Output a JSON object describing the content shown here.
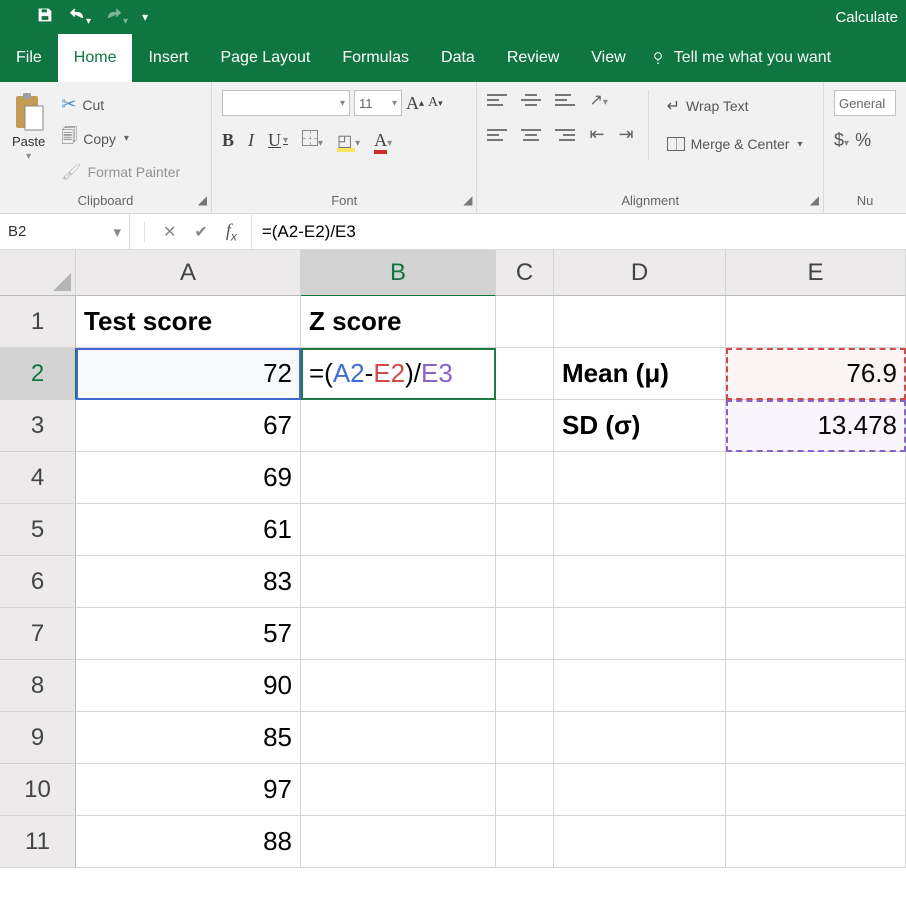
{
  "titlebar": {
    "right_text": "Calculate"
  },
  "tabs": {
    "file": "File",
    "home": "Home",
    "insert": "Insert",
    "page_layout": "Page Layout",
    "formulas": "Formulas",
    "data": "Data",
    "review": "Review",
    "view": "View",
    "tell_me": "Tell me what you want"
  },
  "ribbon": {
    "clipboard": {
      "paste": "Paste",
      "cut": "Cut",
      "copy": "Copy",
      "format_painter": "Format Painter",
      "label": "Clipboard"
    },
    "font": {
      "name": "",
      "size": "11",
      "label": "Font"
    },
    "alignment": {
      "wrap": "Wrap Text",
      "merge": "Merge & Center",
      "label": "Alignment"
    },
    "number": {
      "category": "General",
      "label": "Nu"
    }
  },
  "fx": {
    "namebox": "B2",
    "formula": "=(A2-E2)/E3"
  },
  "grid": {
    "columns": {
      "A": "A",
      "B": "B",
      "C": "C",
      "D": "D",
      "E": "E"
    },
    "rows": {
      "r1": {
        "n": "1",
        "A": "Test score",
        "B": "Z score",
        "C": "",
        "D": "",
        "E": ""
      },
      "r2": {
        "n": "2",
        "A": "72",
        "B_eq": "=(",
        "B_A2": "A2",
        "B_m": "-",
        "B_E2": "E2",
        "B_cd": ")/",
        "B_E3": "E3",
        "C": "",
        "D": "Mean (μ)",
        "E": "76.9"
      },
      "r3": {
        "n": "3",
        "A": "67",
        "B": "",
        "C": "",
        "D": "SD (σ)",
        "E": "13.478"
      },
      "r4": {
        "n": "4",
        "A": "69"
      },
      "r5": {
        "n": "5",
        "A": "61"
      },
      "r6": {
        "n": "6",
        "A": "83"
      },
      "r7": {
        "n": "7",
        "A": "57"
      },
      "r8": {
        "n": "8",
        "A": "90"
      },
      "r9": {
        "n": "9",
        "A": "85"
      },
      "r10": {
        "n": "10",
        "A": "97"
      },
      "r11": {
        "n": "11",
        "A": "88"
      }
    }
  }
}
